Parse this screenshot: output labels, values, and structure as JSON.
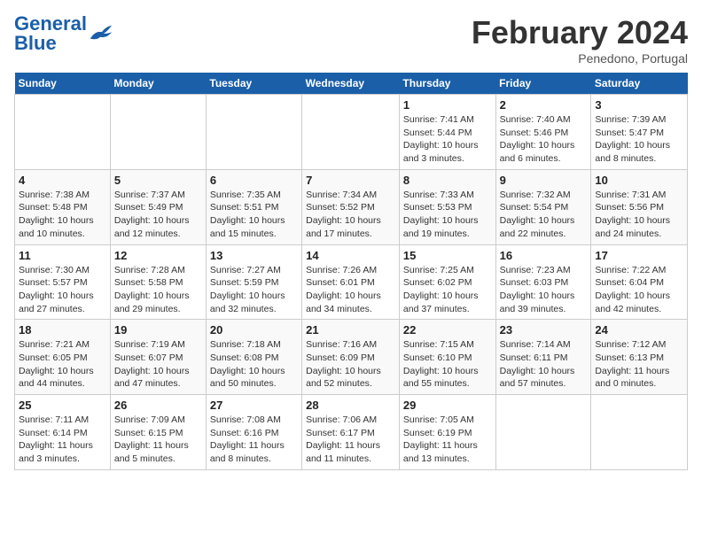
{
  "header": {
    "logo_general": "General",
    "logo_blue": "Blue",
    "month_title": "February 2024",
    "location": "Penedono, Portugal"
  },
  "days_of_week": [
    "Sunday",
    "Monday",
    "Tuesday",
    "Wednesday",
    "Thursday",
    "Friday",
    "Saturday"
  ],
  "weeks": [
    {
      "days": [
        {
          "num": "",
          "info": ""
        },
        {
          "num": "",
          "info": ""
        },
        {
          "num": "",
          "info": ""
        },
        {
          "num": "",
          "info": ""
        },
        {
          "num": "1",
          "info": "Sunrise: 7:41 AM\nSunset: 5:44 PM\nDaylight: 10 hours and 3 minutes."
        },
        {
          "num": "2",
          "info": "Sunrise: 7:40 AM\nSunset: 5:46 PM\nDaylight: 10 hours and 6 minutes."
        },
        {
          "num": "3",
          "info": "Sunrise: 7:39 AM\nSunset: 5:47 PM\nDaylight: 10 hours and 8 minutes."
        }
      ]
    },
    {
      "days": [
        {
          "num": "4",
          "info": "Sunrise: 7:38 AM\nSunset: 5:48 PM\nDaylight: 10 hours and 10 minutes."
        },
        {
          "num": "5",
          "info": "Sunrise: 7:37 AM\nSunset: 5:49 PM\nDaylight: 10 hours and 12 minutes."
        },
        {
          "num": "6",
          "info": "Sunrise: 7:35 AM\nSunset: 5:51 PM\nDaylight: 10 hours and 15 minutes."
        },
        {
          "num": "7",
          "info": "Sunrise: 7:34 AM\nSunset: 5:52 PM\nDaylight: 10 hours and 17 minutes."
        },
        {
          "num": "8",
          "info": "Sunrise: 7:33 AM\nSunset: 5:53 PM\nDaylight: 10 hours and 19 minutes."
        },
        {
          "num": "9",
          "info": "Sunrise: 7:32 AM\nSunset: 5:54 PM\nDaylight: 10 hours and 22 minutes."
        },
        {
          "num": "10",
          "info": "Sunrise: 7:31 AM\nSunset: 5:56 PM\nDaylight: 10 hours and 24 minutes."
        }
      ]
    },
    {
      "days": [
        {
          "num": "11",
          "info": "Sunrise: 7:30 AM\nSunset: 5:57 PM\nDaylight: 10 hours and 27 minutes."
        },
        {
          "num": "12",
          "info": "Sunrise: 7:28 AM\nSunset: 5:58 PM\nDaylight: 10 hours and 29 minutes."
        },
        {
          "num": "13",
          "info": "Sunrise: 7:27 AM\nSunset: 5:59 PM\nDaylight: 10 hours and 32 minutes."
        },
        {
          "num": "14",
          "info": "Sunrise: 7:26 AM\nSunset: 6:01 PM\nDaylight: 10 hours and 34 minutes."
        },
        {
          "num": "15",
          "info": "Sunrise: 7:25 AM\nSunset: 6:02 PM\nDaylight: 10 hours and 37 minutes."
        },
        {
          "num": "16",
          "info": "Sunrise: 7:23 AM\nSunset: 6:03 PM\nDaylight: 10 hours and 39 minutes."
        },
        {
          "num": "17",
          "info": "Sunrise: 7:22 AM\nSunset: 6:04 PM\nDaylight: 10 hours and 42 minutes."
        }
      ]
    },
    {
      "days": [
        {
          "num": "18",
          "info": "Sunrise: 7:21 AM\nSunset: 6:05 PM\nDaylight: 10 hours and 44 minutes."
        },
        {
          "num": "19",
          "info": "Sunrise: 7:19 AM\nSunset: 6:07 PM\nDaylight: 10 hours and 47 minutes."
        },
        {
          "num": "20",
          "info": "Sunrise: 7:18 AM\nSunset: 6:08 PM\nDaylight: 10 hours and 50 minutes."
        },
        {
          "num": "21",
          "info": "Sunrise: 7:16 AM\nSunset: 6:09 PM\nDaylight: 10 hours and 52 minutes."
        },
        {
          "num": "22",
          "info": "Sunrise: 7:15 AM\nSunset: 6:10 PM\nDaylight: 10 hours and 55 minutes."
        },
        {
          "num": "23",
          "info": "Sunrise: 7:14 AM\nSunset: 6:11 PM\nDaylight: 10 hours and 57 minutes."
        },
        {
          "num": "24",
          "info": "Sunrise: 7:12 AM\nSunset: 6:13 PM\nDaylight: 11 hours and 0 minutes."
        }
      ]
    },
    {
      "days": [
        {
          "num": "25",
          "info": "Sunrise: 7:11 AM\nSunset: 6:14 PM\nDaylight: 11 hours and 3 minutes."
        },
        {
          "num": "26",
          "info": "Sunrise: 7:09 AM\nSunset: 6:15 PM\nDaylight: 11 hours and 5 minutes."
        },
        {
          "num": "27",
          "info": "Sunrise: 7:08 AM\nSunset: 6:16 PM\nDaylight: 11 hours and 8 minutes."
        },
        {
          "num": "28",
          "info": "Sunrise: 7:06 AM\nSunset: 6:17 PM\nDaylight: 11 hours and 11 minutes."
        },
        {
          "num": "29",
          "info": "Sunrise: 7:05 AM\nSunset: 6:19 PM\nDaylight: 11 hours and 13 minutes."
        },
        {
          "num": "",
          "info": ""
        },
        {
          "num": "",
          "info": ""
        }
      ]
    }
  ]
}
